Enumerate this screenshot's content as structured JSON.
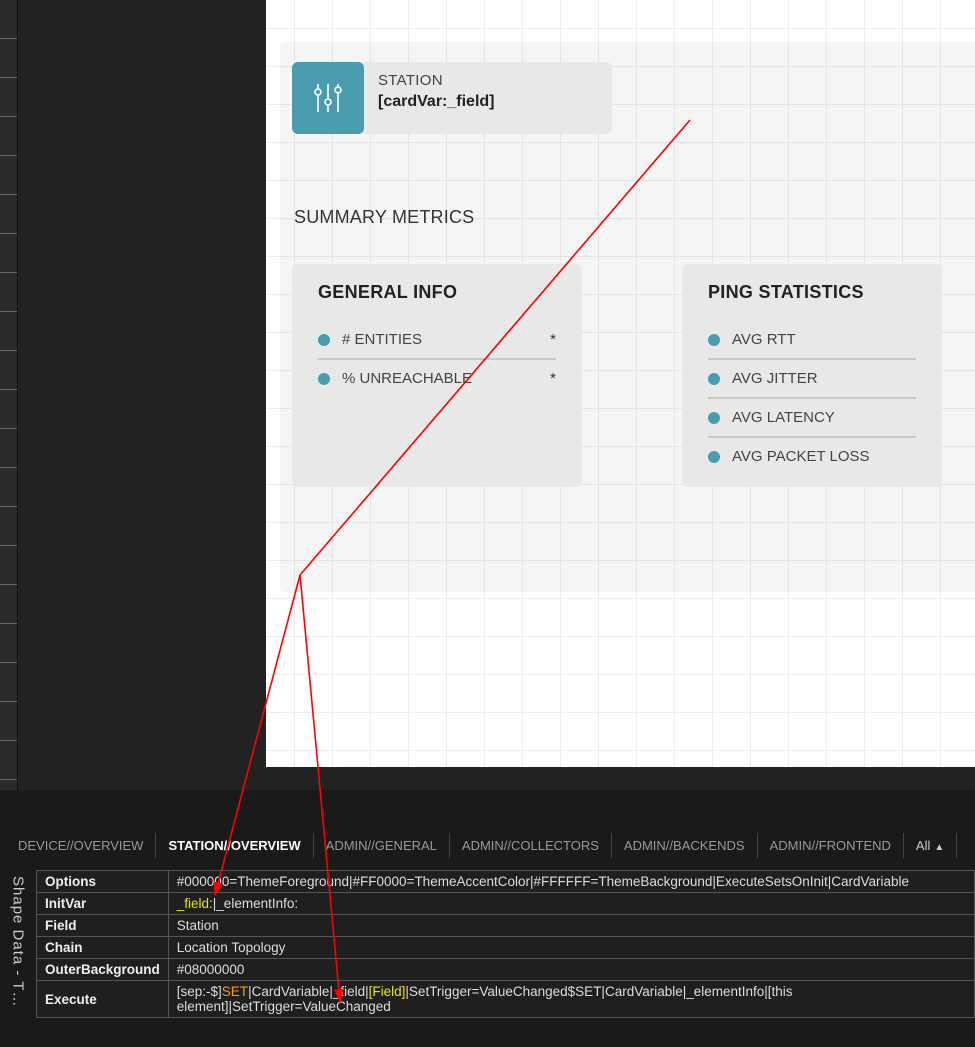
{
  "canvas": {
    "station": {
      "label": "STATION",
      "value": "[cardVar:_field]"
    },
    "sectionTitle": "SUMMARY METRICS",
    "generalInfo": {
      "title": "GENERAL INFO",
      "rows": [
        {
          "label": "# ENTITIES",
          "value": "*"
        },
        {
          "label": "% UNREACHABLE",
          "value": "*"
        }
      ]
    },
    "pingStats": {
      "title": "PING STATISTICS",
      "rows": [
        {
          "label": "AVG RTT"
        },
        {
          "label": "AVG JITTER"
        },
        {
          "label": "AVG LATENCY"
        },
        {
          "label": "AVG PACKET LOSS"
        }
      ]
    }
  },
  "tabs": [
    "DEVICE//OVERVIEW",
    "STATION//OVERVIEW",
    "ADMIN//GENERAL",
    "ADMIN//COLLECTORS",
    "ADMIN//BACKENDS",
    "ADMIN//FRONTEND"
  ],
  "tabsAll": "All",
  "props": {
    "Options": {
      "plain": "#000000=ThemeForeground|#FF0000=ThemeAccentColor|#FFFFFF=ThemeBackground|ExecuteSetsOnInit|CardVariable"
    },
    "InitVar": {
      "hl": "_field:",
      "rest": "|_elementInfo:"
    },
    "Field": {
      "plain": "Station"
    },
    "Chain": {
      "plain": "Location Topology"
    },
    "OuterBackground": {
      "plain": "#08000000"
    },
    "Execute": {
      "p1": "[sep:-$]",
      "o1": "SET",
      "p2": "|CardVariable|_field|",
      "y1": "[Field]",
      "p3": "|SetTrigger=ValueChanged",
      "p4": "$SET|CardVariable|_elementInfo|[this element]|SetTrigger=ValueChanged"
    }
  },
  "sideLabel": "Shape Data - T…"
}
